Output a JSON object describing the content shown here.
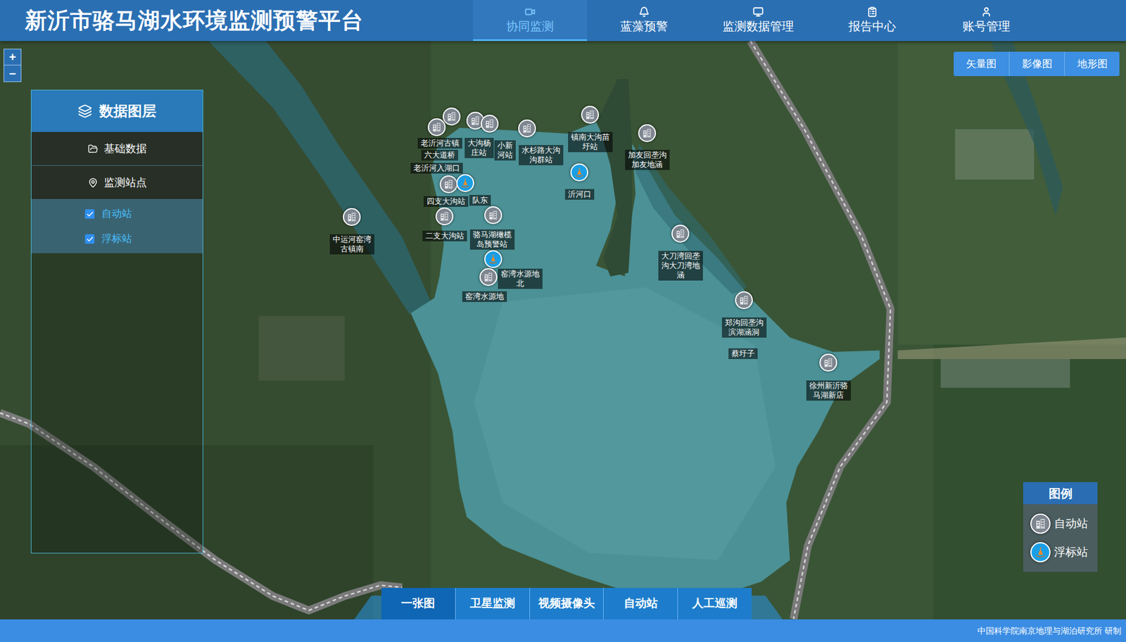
{
  "header": {
    "title": "新沂市骆马湖水环境监测预警平台",
    "nav": [
      {
        "label": "协同监测",
        "selected": true
      },
      {
        "label": "蓝藻预警",
        "selected": false
      },
      {
        "label": "监测数据管理",
        "selected": false
      },
      {
        "label": "报告中心",
        "selected": false
      },
      {
        "label": "账号管理",
        "selected": false
      }
    ]
  },
  "zoom": {
    "in": "+",
    "out": "−"
  },
  "mapTypes": [
    {
      "label": "矢量图"
    },
    {
      "label": "影像图"
    },
    {
      "label": "地形图"
    }
  ],
  "layerPanel": {
    "title": "数据图层",
    "groups": [
      {
        "label": "基础数据",
        "children": []
      },
      {
        "label": "监测站点",
        "children": [
          {
            "label": "自动站",
            "checked": true
          },
          {
            "label": "浮标站",
            "checked": true
          }
        ]
      }
    ]
  },
  "stations": [
    {
      "name": "老沂河古镇",
      "kind": "auto",
      "showIcon": true
    },
    {
      "name": "六大道桥",
      "kind": "auto",
      "showIcon": true
    },
    {
      "name": "大沟杨庄站",
      "kind": "auto",
      "showIcon": true
    },
    {
      "name": "小新河站",
      "kind": "auto",
      "showIcon": true
    },
    {
      "name": "老沂河入湖口",
      "kind": "auto",
      "showIcon": false
    },
    {
      "name": "四支大沟站",
      "kind": "auto",
      "showIcon": true
    },
    {
      "name": "队东",
      "kind": "buoy",
      "showIcon": true
    },
    {
      "name": "二支大沟站",
      "kind": "auto",
      "showIcon": true
    },
    {
      "name": "骆马湖橄榄岛预警站",
      "kind": "auto",
      "showIcon": true
    },
    {
      "kind": "buoy",
      "showIcon": true
    },
    {
      "name": "窑湾水源地北",
      "kind": "auto",
      "showIcon": true
    },
    {
      "name": "窑湾水源地",
      "kind": "auto",
      "showIcon": false
    },
    {
      "name": "水杉路大沟沟群站",
      "kind": "auto",
      "showIcon": true
    },
    {
      "name": "镇南大沟苗圩站",
      "kind": "auto",
      "showIcon": true
    },
    {
      "name": "沂河口",
      "kind": "buoy",
      "showIcon": true
    },
    {
      "name": "加友回垄沟加友地涵",
      "kind": "auto",
      "showIcon": true
    },
    {
      "name": "中运河窑湾古镇南",
      "kind": "auto",
      "showIcon": true
    },
    {
      "name": "大刀湾回垄沟大刀湾地涵",
      "kind": "auto",
      "showIcon": true
    },
    {
      "name": "郑沟回垄沟滨湖涵洞",
      "kind": "auto",
      "showIcon": true
    },
    {
      "name": "蔡圩子",
      "kind": "auto",
      "showIcon": false
    },
    {
      "name": "徐州新沂骆马湖新店",
      "kind": "auto",
      "showIcon": true
    }
  ],
  "legend": {
    "title": "图例",
    "items": [
      {
        "label": "自动站",
        "kind": "auto"
      },
      {
        "label": "浮标站",
        "kind": "buoy"
      }
    ]
  },
  "bottomTabs": [
    {
      "label": "一张图",
      "selected": true
    },
    {
      "label": "卫星监测",
      "selected": false
    },
    {
      "label": "视频摄像头",
      "selected": false
    },
    {
      "label": "自动站",
      "selected": false
    },
    {
      "label": "人工巡测",
      "selected": false
    }
  ],
  "footer": {
    "credit": "中国科学院南京地理与湖泊研究所 研制"
  }
}
